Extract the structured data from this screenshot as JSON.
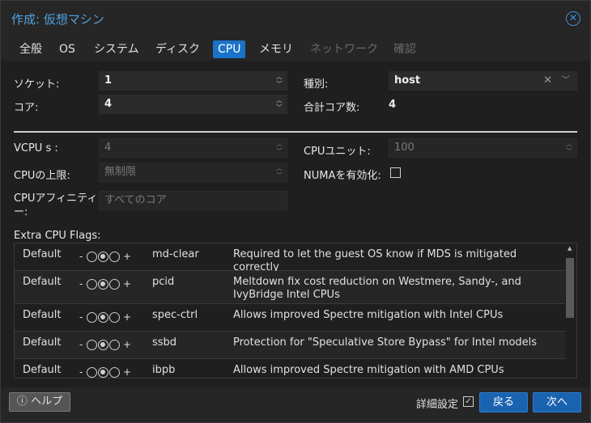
{
  "window": {
    "title": "作成: 仮想マシン"
  },
  "tabs": [
    {
      "label": "全般"
    },
    {
      "label": "OS"
    },
    {
      "label": "システム"
    },
    {
      "label": "ディスク"
    },
    {
      "label": "CPU"
    },
    {
      "label": "メモリ"
    },
    {
      "label": "ネットワーク"
    },
    {
      "label": "確認"
    }
  ],
  "cpu": {
    "sockets_label": "ソケット:",
    "sockets_value": "1",
    "cores_label": "コア:",
    "cores_value": "4",
    "type_label": "種別:",
    "type_value": "host",
    "total_label": "合計コア数:",
    "total_value": "4",
    "vcpus_label": "VCPU s :",
    "vcpus_value": "4",
    "cpu_unit_label": "CPUユニット:",
    "cpu_unit_value": "100",
    "cpu_limit_label": "CPUの上限:",
    "cpu_limit_value": "無制限",
    "numa_label": "NUMAを有効化:",
    "affinity_label_1": "CPUアフィニティ",
    "affinity_label_2": "ー:",
    "affinity_placeholder": "すべてのコア",
    "flags_label": "Extra CPU Flags:"
  },
  "flags": [
    {
      "state": "Default",
      "name": "md-clear",
      "desc": "Required to let the guest OS know if MDS is mitigated correctly"
    },
    {
      "state": "Default",
      "name": "pcid",
      "desc": "Meltdown fix cost reduction on Westmere, Sandy-, and IvyBridge Intel CPUs"
    },
    {
      "state": "Default",
      "name": "spec-ctrl",
      "desc": "Allows improved Spectre mitigation with Intel CPUs"
    },
    {
      "state": "Default",
      "name": "ssbd",
      "desc": "Protection for \"Speculative Store Bypass\" for Intel models"
    },
    {
      "state": "Default",
      "name": "ibpb",
      "desc": "Allows improved Spectre mitigation with AMD CPUs"
    }
  ],
  "toggle": {
    "minus": "-",
    "plus": "+"
  },
  "footer": {
    "help_label": "ヘルプ",
    "advanced_label": "詳細設定",
    "back_label": "戻る",
    "next_label": "次へ"
  }
}
